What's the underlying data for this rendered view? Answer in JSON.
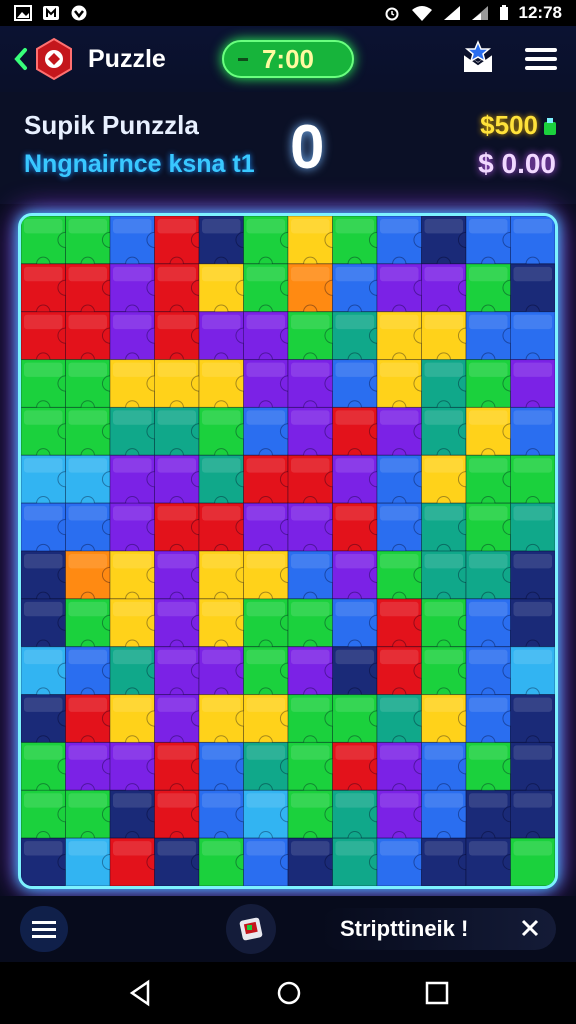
{
  "status_bar": {
    "time": "12:78",
    "left_icons": [
      "gallery-icon",
      "app-icon",
      "shield-icon"
    ],
    "right_icons": [
      "alarm-icon",
      "wifi-icon",
      "signal-icon",
      "signal-icon",
      "battery-icon"
    ]
  },
  "app_bar": {
    "title": "Puzzle",
    "timer": "7:00",
    "icons": [
      "back-chevron-icon",
      "app-logo-icon",
      "star-mail-icon",
      "hamburger-menu-icon"
    ]
  },
  "info": {
    "puzzle_name": "Supik Punzzla",
    "subtitle": "Nngnairnce ksna t1",
    "score": "0",
    "coins": "$500",
    "balance": "$ 0.00"
  },
  "board": {
    "columns": 12,
    "rows": 14,
    "colors": {
      "R": "#e3121b",
      "Y": "#ffd21a",
      "G": "#1bd13d",
      "B": "#2a6ef0",
      "P": "#7b22e6",
      "T": "#10a88a",
      "O": "#ff8a12",
      "N": "#1a2a78",
      "L": "#32b4f2"
    },
    "grid": [
      "GGBRNGYGBNBB",
      "RRPRYGOBPPGN",
      "RRPRPPGTYYBB",
      "GGYYYPPBYTGP",
      "GGTTGBPRPTYB",
      "LLPPTRRPBYGG",
      "BBPRRPPRBTGT",
      "NOYPYYBPGTTN",
      "NGYPYGGBRGBN",
      "LBTPPGPNRGBL",
      "NRYPYYGGTYBN",
      "GPPRBTGRPBGN",
      "GGNRBLGTPBNN",
      "NLRNGBNTBNNG"
    ]
  },
  "bottom_bar": {
    "pill_label": "Stripttineik !",
    "icons": [
      "list-menu-icon",
      "puzzle-book-icon",
      "close-icon"
    ]
  },
  "nav_bar": {
    "icons": [
      "nav-back-icon",
      "nav-home-icon",
      "nav-recents-icon"
    ]
  }
}
